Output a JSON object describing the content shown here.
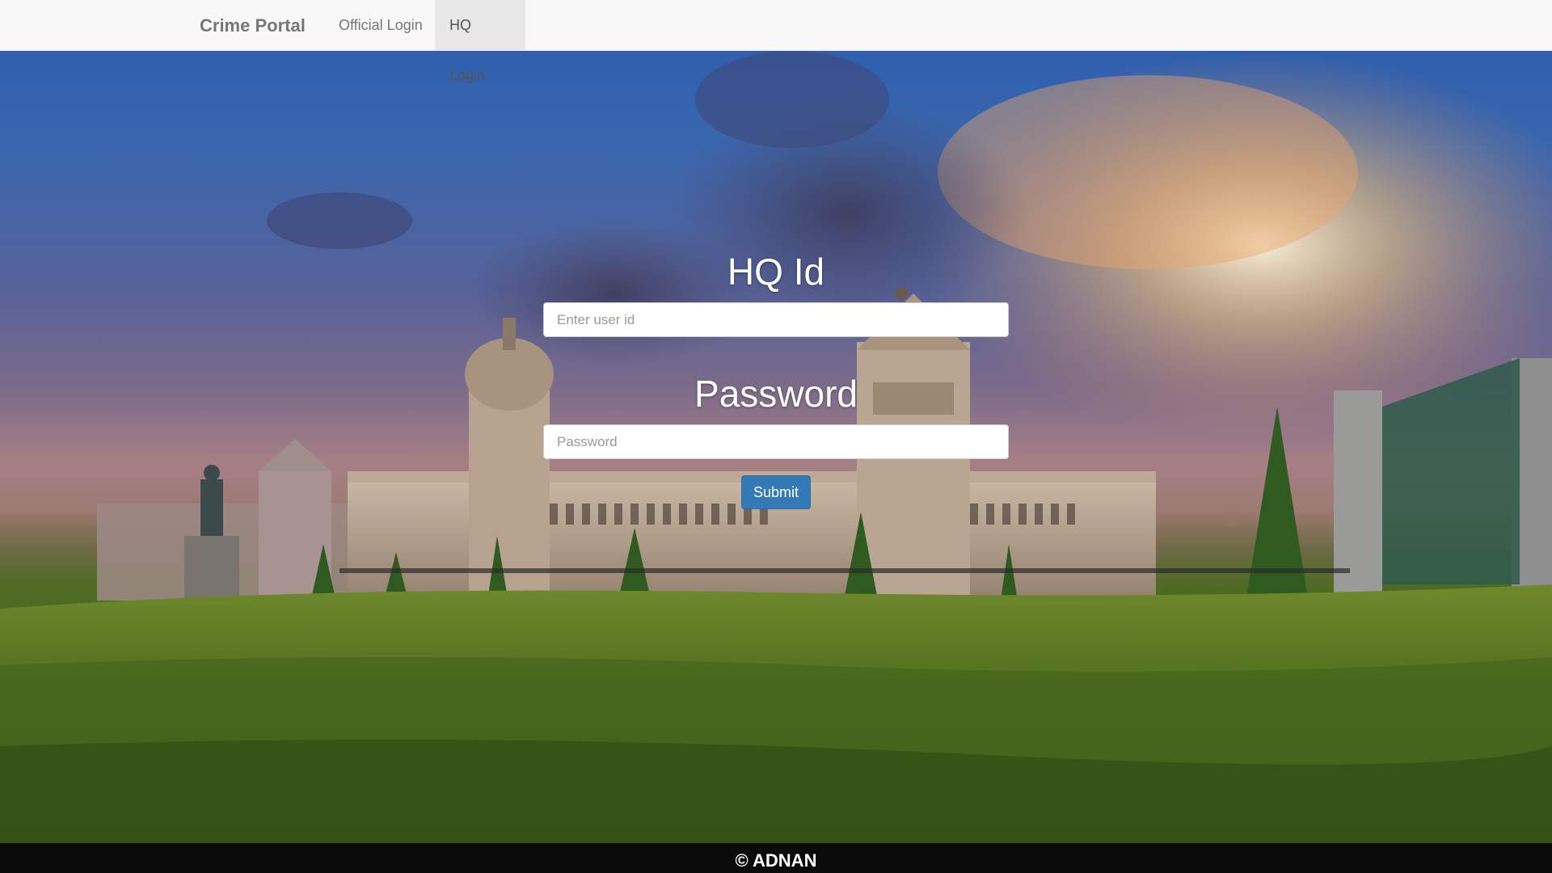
{
  "navbar": {
    "brand": "Crime Portal",
    "items": [
      {
        "label": "Official Login",
        "active": false
      },
      {
        "label": "HQ Login",
        "active": true
      }
    ]
  },
  "login_form": {
    "userid_title": "HQ Id",
    "userid_placeholder": "Enter user id",
    "password_title": "Password",
    "password_placeholder": "Password",
    "submit_label": "Submit"
  },
  "footer": {
    "text": "© ADNAN"
  },
  "colors": {
    "navbar_bg": "#f8f8f8",
    "active_tab_bg": "#e7e7e7",
    "submit_bg": "#337ab7",
    "footer_bg": "#0b0b0b"
  }
}
